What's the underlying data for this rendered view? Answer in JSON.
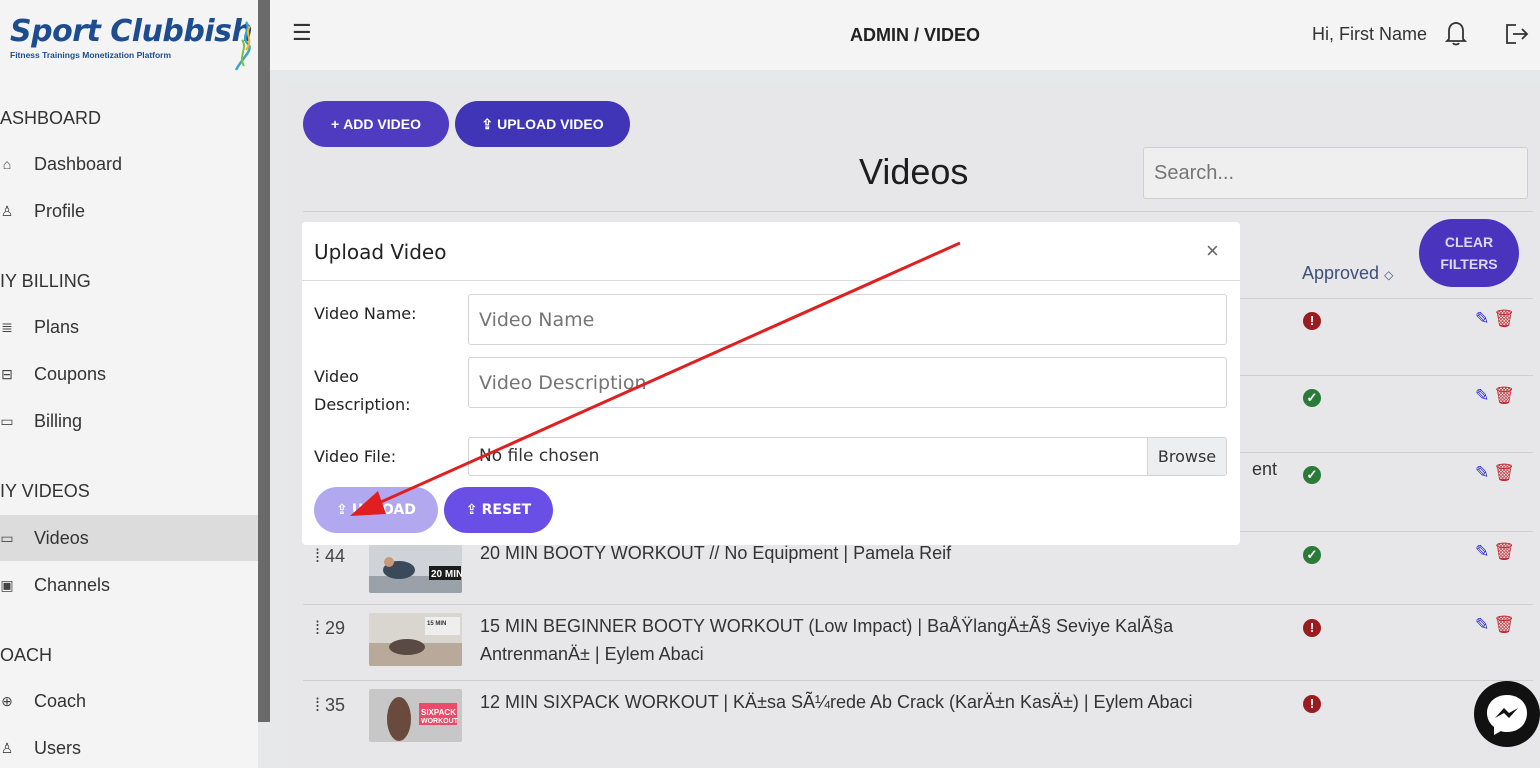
{
  "brand": {
    "name": "Sport Clubbish",
    "tagline": "Fitness Trainings Monetization Platform"
  },
  "sidebar": {
    "sections": [
      {
        "title": "ASHBOARD"
      },
      {
        "title": "IY BILLING"
      },
      {
        "title": "IY VIDEOS"
      },
      {
        "title": "OACH"
      }
    ],
    "items": [
      {
        "label": "Dashboard",
        "icon": "home-icon"
      },
      {
        "label": "Profile",
        "icon": "user-icon"
      },
      {
        "label": "Plans",
        "icon": "list-icon"
      },
      {
        "label": "Coupons",
        "icon": "coupon-icon"
      },
      {
        "label": "Billing",
        "icon": "card-icon"
      },
      {
        "label": "Videos",
        "icon": "video-icon"
      },
      {
        "label": "Channels",
        "icon": "play-icon"
      },
      {
        "label": "Coach",
        "icon": "globe-icon"
      },
      {
        "label": "Users",
        "icon": "users-icon"
      }
    ]
  },
  "header": {
    "title": "ADMIN / VIDEO",
    "greeting": "Hi, First Name"
  },
  "toolbar": {
    "add_label": "ADD VIDEO",
    "upload_label": "UPLOAD VIDEO"
  },
  "main": {
    "title": "Videos",
    "search_placeholder": "Search...",
    "clear_filters": "CLEAR FILTERS",
    "approved_header": "Approved",
    "partial_text": "ent"
  },
  "rows": [
    {
      "id": "",
      "title": "",
      "approved": false
    },
    {
      "id": "",
      "title": "",
      "approved": true
    },
    {
      "id": "",
      "title": "",
      "approved": true
    },
    {
      "id": "44",
      "title": "20 MIN BOOTY WORKOUT // No Equipment | Pamela Reif",
      "approved": true
    },
    {
      "id": "29",
      "title": "15 MIN BEGINNER BOOTY WORKOUT (Low Impact) | BaÅŸlangÄ±Ã§ Seviye KalÃ§a AntrenmanÄ± | Eylem Abaci",
      "approved": false
    },
    {
      "id": "35",
      "title": "12 MIN SIXPACK WORKOUT | KÄ±sa SÃ¼rede Ab Crack (KarÄ±n KasÄ±) | Eylem Abaci",
      "approved": false
    }
  ],
  "thumbnails": [
    {
      "caption": "20 MIN",
      "sub": "BOOTY WORKOUT"
    },
    {
      "caption": "15 MIN",
      "sub": "BEGINNER BOOTY"
    },
    {
      "caption": "SIXPACK",
      "sub": "WORKOUT"
    }
  ],
  "modal": {
    "title": "Upload Video",
    "close": "×",
    "name_label": "Video Name:",
    "name_placeholder": "Video Name",
    "desc_label_1": "Video",
    "desc_label_2": "Description:",
    "desc_placeholder": "Video Description",
    "file_label": "Video File:",
    "file_value": "No file chosen",
    "browse": "Browse",
    "upload_btn": "UPLOAD",
    "reset_btn": "RESET"
  },
  "colors": {
    "primary": "#4b2fb8",
    "danger": "#9b1c20",
    "success": "#2a7a3a",
    "annotation": "#e02020"
  }
}
